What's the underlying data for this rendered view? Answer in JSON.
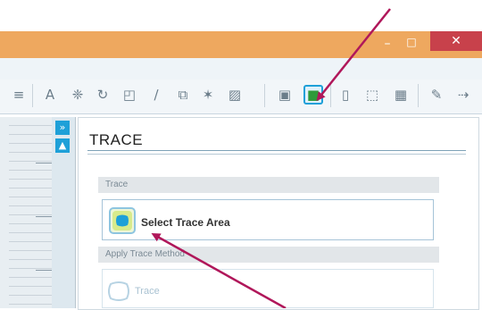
{
  "window": {
    "minimize_glyph": "–",
    "maximize_glyph": "□",
    "close_glyph": "✕",
    "titlebar_color": "#eea85f",
    "close_color": "#c8414b"
  },
  "toolbar": {
    "tools": [
      {
        "name": "align-icon",
        "glyph": "≡"
      },
      {
        "name": "text-tool-icon",
        "glyph": "A"
      },
      {
        "name": "replicate-icon",
        "glyph": "❈"
      },
      {
        "name": "rotate-icon",
        "glyph": "↻"
      },
      {
        "name": "transform-icon",
        "glyph": "◰"
      },
      {
        "name": "line-tool-icon",
        "glyph": "∕"
      },
      {
        "name": "offset-icon",
        "glyph": "⧉"
      },
      {
        "name": "modify-icon",
        "glyph": "✶"
      },
      {
        "name": "fill-pattern-icon",
        "glyph": "▨"
      },
      {
        "name": "image-library-icon",
        "glyph": "▣"
      },
      {
        "name": "trace-icon",
        "glyph": "■",
        "active": true
      },
      {
        "name": "page-setup-icon",
        "glyph": "▯"
      },
      {
        "name": "registration-marks-icon",
        "glyph": "⬚"
      },
      {
        "name": "grid-icon",
        "glyph": "▦"
      },
      {
        "name": "cut-settings-icon",
        "glyph": "✎"
      },
      {
        "name": "send-icon",
        "glyph": "⇢"
      }
    ],
    "accent_color": "#1ea0d8"
  },
  "side_panel": {
    "expand_glyph": "»",
    "up_glyph": "▲"
  },
  "trace_panel": {
    "title": "TRACE",
    "trace_section": {
      "header": "Trace",
      "select_button_label": "Select Trace Area"
    },
    "method_section": {
      "header": "Apply Trace Method",
      "trace_button_label": "Trace"
    }
  },
  "annotation": {
    "arrow_color": "#b0175a"
  }
}
